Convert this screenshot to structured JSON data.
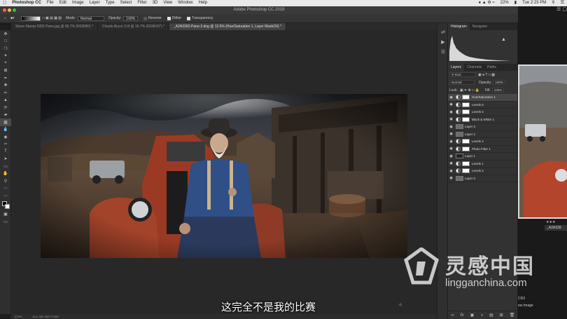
{
  "menubar": {
    "app": "Photoshop CC",
    "items": [
      "File",
      "Edit",
      "Image",
      "Layer",
      "Type",
      "Select",
      "Filter",
      "3D",
      "View",
      "Window",
      "Help"
    ],
    "battery": "22%",
    "clock": "Tue 2:23 PM"
  },
  "window": {
    "title": "Adobe Photoshop CC 2019"
  },
  "options": {
    "mode_label": "Mode:",
    "mode_value": "Normal",
    "opacity_label": "Opacity:",
    "opacity_value": "100%",
    "reverse": "Reverse",
    "dither": "Dither",
    "transparency": "Transparency"
  },
  "tabs": [
    {
      "label": "Steve-Stamp-3392-Pano.jpg @ 66.7% (RGB/8#) *"
    },
    {
      "label": "Clouds Bryce 2.tif @ 16.7% (RGB/16*) *"
    },
    {
      "label": "_A2A3392-Pano-2.dng @ 12.5% (Hue/Saturation 1, Layer Mask/16) *"
    }
  ],
  "status": {
    "zoom": "12.5%",
    "doc": "Doc: 264.3M/773.0M"
  },
  "subtitle": "这完全不是我的比赛",
  "panels": {
    "top_tabs": [
      "Histogram",
      "Navigator"
    ],
    "layer_tabs": [
      "Layers",
      "Channels",
      "Paths"
    ],
    "kind": "Kind",
    "blend": "Normal",
    "opacity_label": "Opacity:",
    "opacity": "100%",
    "lock_label": "Lock:",
    "fill_label": "Fill:",
    "fill": "100%",
    "layers": [
      {
        "name": "Hue/Saturation 1",
        "type": "adjustment",
        "selected": true
      },
      {
        "name": "Levels 6",
        "type": "adjustment"
      },
      {
        "name": "Levels 5",
        "type": "adjustment"
      },
      {
        "name": "Black & White 1",
        "type": "adjustment"
      },
      {
        "name": "Layer 3",
        "type": "pixel"
      },
      {
        "name": "Layer 2",
        "type": "pixel"
      },
      {
        "name": "Levels 4",
        "type": "adjustment"
      },
      {
        "name": "Photo Filter 1",
        "type": "adjustment"
      },
      {
        "name": "Layer 1",
        "type": "pixel-dark"
      },
      {
        "name": "Levels 1",
        "type": "adjustment"
      },
      {
        "name": "Levels 2",
        "type": "adjustment"
      },
      {
        "name": "Layer 0",
        "type": "pixel"
      }
    ]
  },
  "desk": {
    "stars": "★★★",
    "file_label": "_A2A339",
    "caption1": "CR3",
    "caption2": "ew Image"
  },
  "watermark": {
    "brand_cn": "灵感中国",
    "brand_en": "lingganchina.com"
  }
}
